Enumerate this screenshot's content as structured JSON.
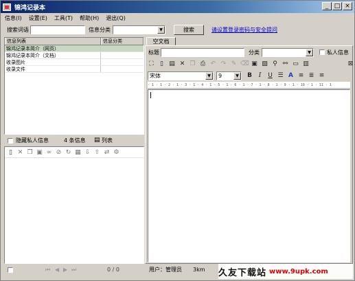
{
  "window": {
    "title": "锦鸿记录本",
    "minimize": "_",
    "maximize": "□",
    "close": "×"
  },
  "menu": [
    "信息(I)",
    "设置(E)",
    "工具(T)",
    "帮助(H)",
    "退出(Q)"
  ],
  "search": {
    "keyword_label": "搜索词语",
    "keyword_value": "",
    "category_label": "信息分类",
    "category_value": "",
    "button": "搜索",
    "link": "请设置登录密码与安全提问"
  },
  "info_list": {
    "headers": [
      "信息列表",
      "信息分类"
    ],
    "rows": [
      {
        "name": "锦鸿记录本简介（网页）",
        "category": ""
      },
      {
        "name": "锦鸿记录本简介（文档）",
        "category": ""
      },
      {
        "name": "收录图片",
        "category": ""
      },
      {
        "name": "收录文件",
        "category": ""
      }
    ]
  },
  "left_controls": {
    "hide_private": "隐藏私人信息",
    "count": "4 条信息",
    "list_view": "列表"
  },
  "left_status": {
    "pager": "0 / 0"
  },
  "editor": {
    "tab": "空文档",
    "title_label": "标题",
    "title_value": "",
    "category_label": "分类",
    "category_value": "",
    "private_label": "私人信息",
    "font_name": "宋体",
    "font_size": "9",
    "bold": "B",
    "italic": "I",
    "underline": "U",
    "ruler": "· 1 · 1 · 2 · 1 · 3 · 1 · 4 · 1 · 5 · 1 · 6 · 1 · 7 · 1 · 8 · 1 · 9 · 1 · 10 · 1 · 11 · 1"
  },
  "status": {
    "user": "用户：管理员",
    "extra": "3km"
  },
  "watermark": {
    "text": "久友下载站",
    "url": "www.9upk.com"
  }
}
